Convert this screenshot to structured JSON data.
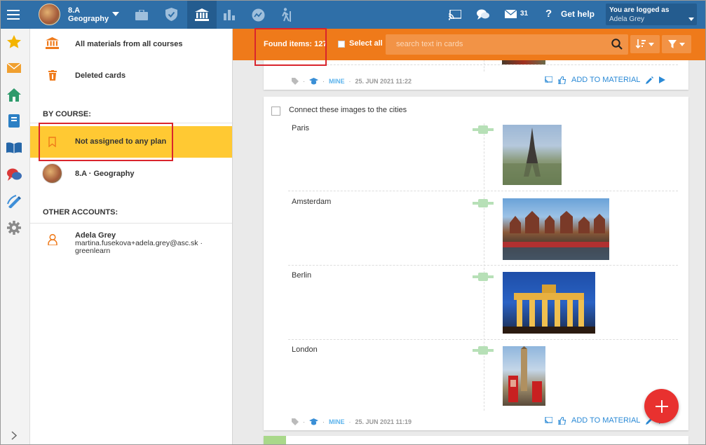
{
  "topbar": {
    "course_line1": "8.A",
    "course_line2": "Geography",
    "message_count": "31",
    "help_label": "Get help",
    "logged_in_label": "You are logged as",
    "user_name": "Adela Grey"
  },
  "sidebar": {
    "all_materials": "All materials from all courses",
    "deleted_cards": "Deleted cards",
    "by_course_heading": "BY COURSE:",
    "not_assigned": "Not assigned to any plan",
    "course_item": "8.A · Geography",
    "other_accounts_heading": "OTHER ACCOUNTS:",
    "account_name": "Adela Grey",
    "account_email": "martina.fusekova+adela.grey@asc.sk ·",
    "account_org": "greenlearn"
  },
  "toolbar": {
    "found_items": "Found items: 127",
    "select_all": "Select all",
    "search_placeholder": "search text in cards"
  },
  "card_top": {
    "mine": "MINE",
    "date": "25. JUN 2021 11:22",
    "add_to_material": "ADD TO MATERIAL"
  },
  "card_main": {
    "question": "Connect these images to the cities",
    "cities": [
      "Paris",
      "Amsterdam",
      "Berlin",
      "London"
    ],
    "mine": "MINE",
    "date": "25. JUN 2021 11:19",
    "add_to_material": "ADD TO MATERIAL"
  },
  "colors": {
    "topbar": "#2f6fa8",
    "accent_orange": "#ef7a1a",
    "highlight_yellow": "#ffc933",
    "link_blue": "#2b8ad6",
    "fab_red": "#e8312f"
  }
}
